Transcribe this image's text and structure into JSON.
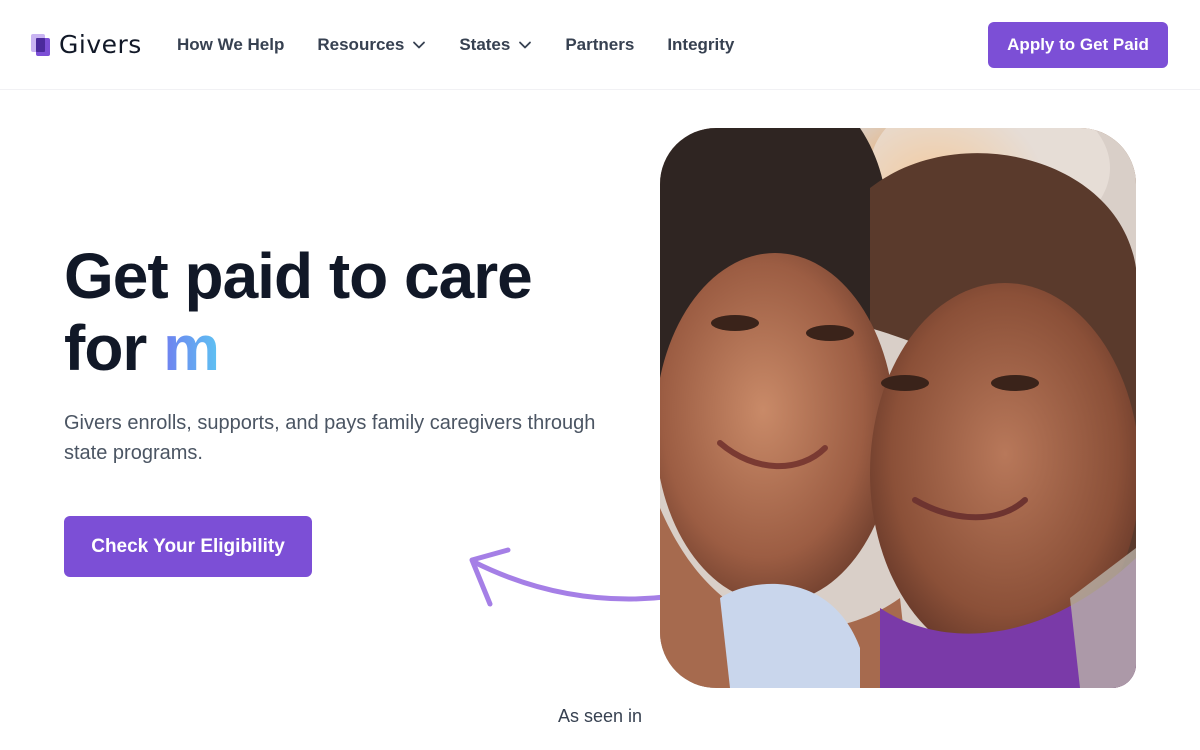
{
  "brand": {
    "name": "Givers",
    "logo_icon": "givers-logo-icon"
  },
  "nav": {
    "items": [
      {
        "label": "How We Help",
        "has_dropdown": false
      },
      {
        "label": "Resources",
        "has_dropdown": true
      },
      {
        "label": "States",
        "has_dropdown": true
      },
      {
        "label": "Partners",
        "has_dropdown": false
      },
      {
        "label": "Integrity",
        "has_dropdown": false
      }
    ],
    "cta_label": "Apply to Get Paid"
  },
  "hero": {
    "title_line1": "Get paid to care",
    "title_line2_prefix": "for",
    "title_typed": "m",
    "subtitle": "Givers enrolls, supports, and pays family caregivers through state programs.",
    "cta_label": "Check Your Eligibility",
    "image_icon": "caregivers-photo"
  },
  "press": {
    "label": "As seen in"
  },
  "colors": {
    "accent": "#7c4fd6",
    "arrow": "#a57fe6",
    "heading": "#111827",
    "typed_gradient_start": "#6f7ff0",
    "typed_gradient_end": "#5ec2f2"
  }
}
